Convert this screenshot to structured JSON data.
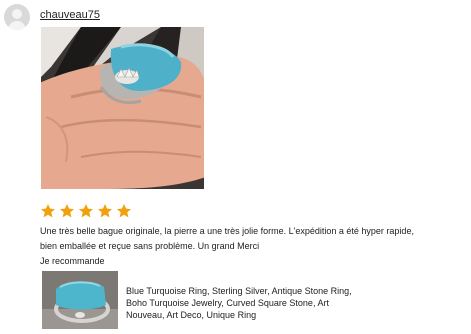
{
  "review": {
    "username": "chauveau75",
    "rating": 5,
    "rating_max": 5,
    "star_color": "#f1a10d",
    "text_line1": "Une très belle bague originale, la pierre a une très jolie forme. L'expédition a été hyper rapide,",
    "text_line2": "bien emballée et reçue sans problème. Un grand Merci",
    "text_line3": "Je recommande"
  },
  "product": {
    "title_line1": "Blue Turquoise Ring, Sterling Silver, Antique Stone Ring,",
    "title_line2": "Boho Turquoise Jewelry, Curved Square Stone, Art",
    "title_line3": "Nouveau, Art Deco, Unique Ring"
  },
  "icons": [
    "user-avatar-icon",
    "star-icon"
  ]
}
